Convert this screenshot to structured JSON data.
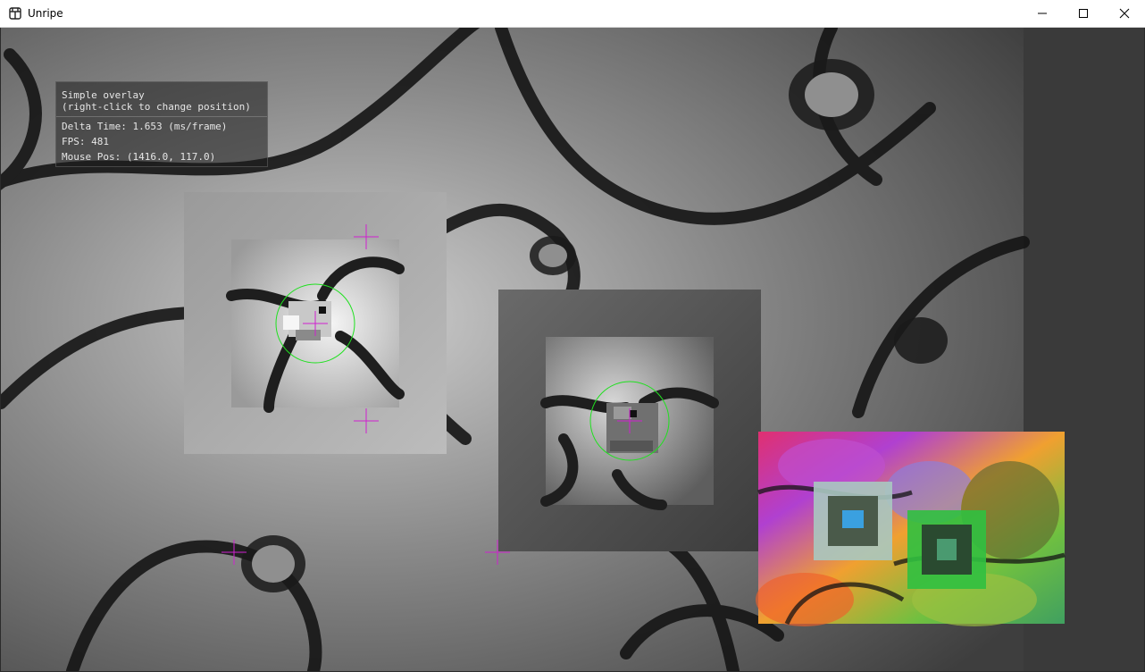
{
  "window": {
    "title": "Unripe",
    "icon": "app-grid-icon",
    "controls": [
      "minimize-icon",
      "maximize-icon",
      "close-icon"
    ]
  },
  "overlay": {
    "title_line1": "Simple overlay",
    "title_line2": "(right-click to change position)",
    "delta_time": "Delta Time: 1.653 (ms/frame)",
    "fps": "FPS: 481",
    "mouse_pos": "Mouse Pos: (1416.0, 117.0)"
  },
  "scene": {
    "background": "flower-pattern",
    "crosshair_color": "#d020d0",
    "circle_color": "#20e020",
    "panels": [
      "grayscale-view-1",
      "grayscale-view-2",
      "color-minimap"
    ]
  }
}
